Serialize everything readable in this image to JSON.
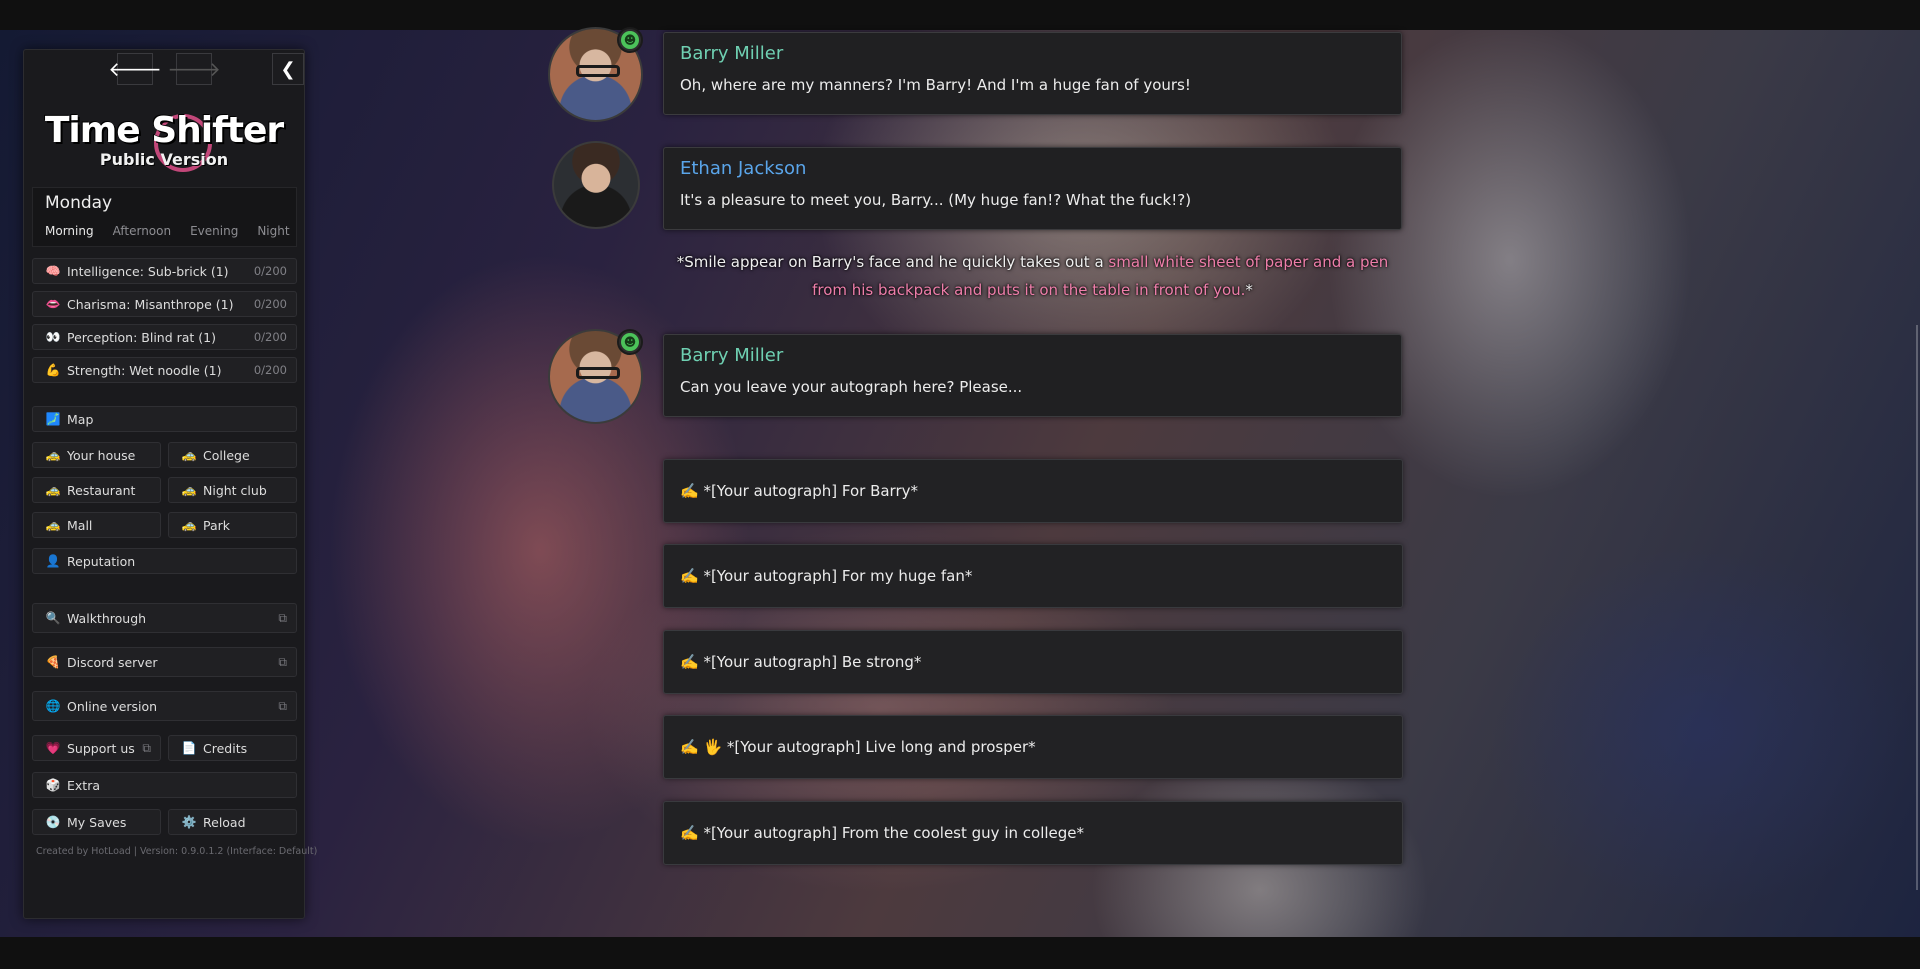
{
  "nav": {
    "back_icon": "arrow-left-icon",
    "forward_icon": "arrow-right-icon",
    "collapse_icon": "chevron-left-icon"
  },
  "logo": {
    "title": "Time Shifter",
    "subtitle": "Public Version"
  },
  "time": {
    "day": "Monday",
    "periods": [
      "Morning",
      "Afternoon",
      "Evening",
      "Night"
    ],
    "active_period": "Morning"
  },
  "stats": [
    {
      "icon": "🧠",
      "label": "Intelligence: Sub-brick (1)",
      "value": "0/200"
    },
    {
      "icon": "👄",
      "label": "Charisma: Misanthrope (1)",
      "value": "0/200"
    },
    {
      "icon": "👀",
      "label": "Perception: Blind rat (1)",
      "value": "0/200"
    },
    {
      "icon": "💪",
      "label": "Strength: Wet noodle (1)",
      "value": "0/200"
    }
  ],
  "map": {
    "icon": "🗾",
    "label": "Map"
  },
  "locations": [
    {
      "icon": "🚕",
      "label": "Your house"
    },
    {
      "icon": "🚕",
      "label": "College"
    },
    {
      "icon": "🚕",
      "label": "Restaurant"
    },
    {
      "icon": "🚕",
      "label": "Night club"
    },
    {
      "icon": "🚕",
      "label": "Mall"
    },
    {
      "icon": "🚕",
      "label": "Park"
    }
  ],
  "reputation": {
    "icon": "👤",
    "label": "Reputation"
  },
  "links": [
    {
      "icon": "🔍",
      "label": "Walkthrough"
    },
    {
      "icon": "🍕",
      "label": "Discord server"
    },
    {
      "icon": "🌐",
      "label": "Online version"
    }
  ],
  "support": {
    "icon": "💗",
    "label": "Support us"
  },
  "credits": {
    "icon": "📄",
    "label": "Credits"
  },
  "extra": {
    "icon": "🎲",
    "label": "Extra"
  },
  "saves": {
    "icon": "💿",
    "label": "My Saves"
  },
  "reload": {
    "icon": "⚙️",
    "label": "Reload"
  },
  "footer": "Created by HotLoad | Version: 0.9.0.1.2 (Interface: Default)",
  "dialogue": [
    {
      "speaker": "Barry Miller",
      "text": "Oh, where are my manners? I'm Barry! And I'm a huge fan of yours!"
    },
    {
      "speaker": "Ethan Jackson",
      "text": "It's a pleasure to meet you, Barry... (My huge fan!? What the fuck!?)"
    },
    {
      "speaker": "Barry Miller",
      "text": "Can you leave your autograph here? Please..."
    }
  ],
  "narration": {
    "plain": "*Smile appear on Barry's face and he quickly takes out a ",
    "highlight": "small white sheet of paper and a pen from his backpack and puts it on the table in front of you.",
    "end": "*"
  },
  "choices": [
    "✍️ *[Your autograph] For Barry*",
    "✍️ *[Your autograph] For my huge fan*",
    "✍️ *[Your autograph] Be strong*",
    "✍️ 🖐️ *[Your autograph] Live long and prosper*",
    "✍️ *[Your autograph] From the coolest guy in college*"
  ],
  "colors": {
    "barry": "#6fd0b2",
    "ethan": "#5aa5ea",
    "highlight": "#ee7eaa",
    "mood_badge": "#4cc35a"
  }
}
